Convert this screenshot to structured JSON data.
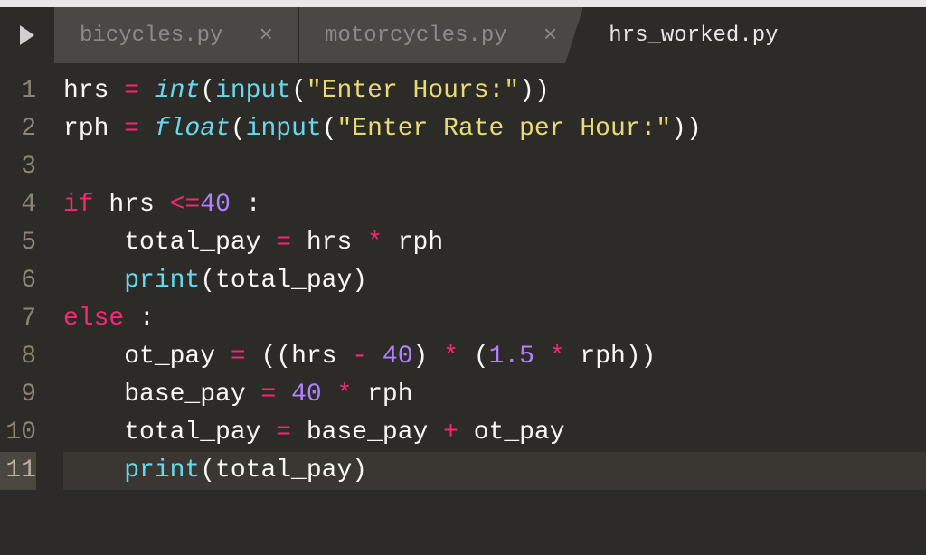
{
  "tabs": [
    {
      "name": "bicycles.py",
      "active": false
    },
    {
      "name": "motorcycles.py",
      "active": false
    },
    {
      "name": "hrs_worked.py",
      "active": true
    }
  ],
  "gutter": [
    "1",
    "2",
    "3",
    "4",
    "5",
    "6",
    "7",
    "8",
    "9",
    "10",
    "11"
  ],
  "active_line": 11,
  "code": {
    "l1": {
      "var1": "hrs",
      "eq": " = ",
      "fn1": "int",
      "p1": "(",
      "fn2": "input",
      "p2": "(",
      "str": "\"Enter Hours:\"",
      "p3": ")",
      "p4": ")"
    },
    "l2": {
      "var1": "rph",
      "eq": " = ",
      "fn1": "float",
      "p1": "(",
      "fn2": "input",
      "p2": "(",
      "str": "\"Enter Rate per Hour:\"",
      "p3": ")",
      "p4": ")"
    },
    "l3": "",
    "l4": {
      "kw": "if",
      "sp": " ",
      "var": "hrs",
      "op": " <=",
      "num": "40",
      "sp2": " ",
      "colon": ":"
    },
    "l5": {
      "indent": "    ",
      "var1": "total_pay",
      "eq": " = ",
      "var2": "hrs",
      "op": " * ",
      "var3": "rph"
    },
    "l6": {
      "indent": "    ",
      "fn": "print",
      "p1": "(",
      "var": "total_pay",
      "p2": ")"
    },
    "l7": {
      "kw": "else",
      "sp": " ",
      "colon": ":"
    },
    "l8": {
      "indent": "    ",
      "var1": "ot_pay",
      "eq": " = ",
      "p1": "((",
      "var2": "hrs",
      "op1": " - ",
      "num1": "40",
      "p2": ")",
      "op2": " * ",
      "p3": "(",
      "num2": "1.5",
      "op3": " * ",
      "var3": "rph",
      "p4": "))"
    },
    "l9": {
      "indent": "    ",
      "var1": "base_pay",
      "eq": " = ",
      "num": "40",
      "op": " * ",
      "var2": "rph"
    },
    "l10": {
      "indent": "    ",
      "var1": "total_pay",
      "eq": " = ",
      "var2": "base_pay",
      "op": " + ",
      "var3": "ot_pay"
    },
    "l11": {
      "indent": "    ",
      "fn": "print",
      "p1": "(",
      "var": "total_pay",
      "p2": ")"
    }
  }
}
